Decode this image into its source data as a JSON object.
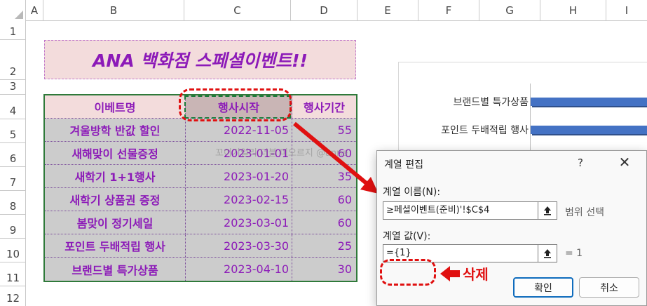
{
  "columns": [
    "A",
    "B",
    "C",
    "D",
    "E",
    "F",
    "G",
    "H",
    "I"
  ],
  "rows": [
    "1",
    "2",
    "3",
    "4",
    "5",
    "6",
    "7",
    "8",
    "9",
    "10",
    "11",
    "12"
  ],
  "title": "ANA 백화점 스페셜이벤트!!",
  "table": {
    "headers": [
      "이베트명",
      "행사시작",
      "행사기간"
    ],
    "rows": [
      [
        "겨울방학 반값 할인",
        "2022-11-05",
        "55"
      ],
      [
        "새해맞이 선물증정",
        "2023-01-01",
        "60"
      ],
      [
        "새학기 1+1행사",
        "2023-01-20",
        "35"
      ],
      [
        "새학기 상품권 증정",
        "2023-02-15",
        "60"
      ],
      [
        "봄맞이 정기세일",
        "2023-03-01",
        "60"
      ],
      [
        "포인트 두배적립 행사",
        "2023-03-30",
        "25"
      ],
      [
        "브랜드별 특가상품",
        "2023-04-10",
        "30"
      ]
    ]
  },
  "watermark": "꼬이기일리 더블 미오르지 @anne",
  "chart": {
    "labels": [
      "브랜드별 특가상품",
      "포인트 두배적립 행사"
    ]
  },
  "dialog": {
    "title": "계열 편집",
    "help": "?",
    "close": "✕",
    "name_label": "계열 이름(N):",
    "name_value": "≥페셜이벤트(준비)'!$C$4",
    "name_side": "범위 선택",
    "values_label": "계열 값(V):",
    "values_value": "={1}",
    "values_side": "= 1",
    "ok": "확인",
    "cancel": "취소"
  },
  "annotation": {
    "delete_label": "삭제"
  },
  "colors": {
    "accent_purple": "#8c1ab8",
    "annotation_red": "#e01010",
    "bar_blue": "#4472c4",
    "table_border_green": "#2f7a3a"
  }
}
